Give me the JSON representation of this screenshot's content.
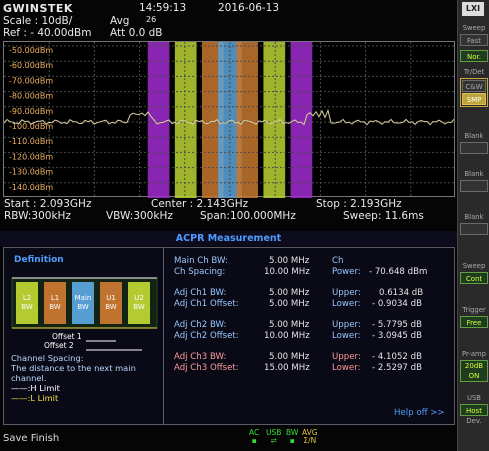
{
  "header": {
    "logo": "GWINSTEK",
    "time": "14:59:13",
    "date": "2016-06-13",
    "scale": "Scale : 10dB/",
    "avg": "Avg",
    "avg_value": "26",
    "ref": "Ref : - 40.00dBm",
    "att": "Att  0.0 dB"
  },
  "plot": {
    "y_labels": [
      "-50.00dBm",
      "-60.00dBm",
      "-70.00dBm",
      "-80.00dBm",
      "-90.00dBm",
      "-100.0dBm",
      "-110.0dBm",
      "-120.0dBm",
      "-130.0dBm",
      "-140.0dBm"
    ],
    "bands": [
      {
        "name": "L3",
        "color": "#a02cd0",
        "x_from": 0.318,
        "x_to": 0.366
      },
      {
        "name": "L2",
        "color": "#bcd432",
        "x_from": 0.378,
        "x_to": 0.426
      },
      {
        "name": "L1",
        "color": "#c87830",
        "x_from": 0.438,
        "x_to": 0.486
      },
      {
        "name": "Main",
        "color": "#5aa4dc",
        "x_from": 0.474,
        "x_to": 0.526
      },
      {
        "name": "U1",
        "color": "#c87830",
        "x_from": 0.514,
        "x_to": 0.562
      },
      {
        "name": "U2",
        "color": "#bcd432",
        "x_from": 0.574,
        "x_to": 0.622
      },
      {
        "name": "U3",
        "color": "#a02cd0",
        "x_from": 0.634,
        "x_to": 0.682
      }
    ]
  },
  "footer": {
    "start": "Start : 2.093GHz",
    "center": "Center : 2.143GHz",
    "stop": "Stop : 2.193GHz",
    "rbw": "RBW:300kHz",
    "vbw": "VBW:300kHz",
    "span": "Span:100.000MHz",
    "sweep": "Sweep: 11.6ms"
  },
  "acpr": {
    "title": "ACPR Measurement",
    "definition_title": "Definition",
    "blocks": [
      {
        "label": "L2\nBW",
        "color": "#bcd432"
      },
      {
        "label": "L1\nBW",
        "color": "#c87830"
      },
      {
        "label": "Main\nBW",
        "color": "#5aa4dc"
      },
      {
        "label": "U1\nBW",
        "color": "#c87830"
      },
      {
        "label": "U2\nBW",
        "color": "#bcd432"
      }
    ],
    "offset1": "Offset 1",
    "offset2": "Offset 2",
    "channel_spacing": "Channel Spacing:",
    "channel_spacing_desc": "The distance to the next main channel.",
    "h_limit": "——:H Limit",
    "l_limit": "——:L Limit",
    "main_ch_bw_label": "Main Ch BW:",
    "main_ch_bw_value": "5.00 MHz",
    "ch_spacing_label": "Ch Spacing:",
    "ch_spacing_value": "10.00 MHz",
    "ch_label": "Ch",
    "ch_power_label": "Power:",
    "ch_power_value": "- 70.648 dBm",
    "adj": [
      {
        "bw_label": "Adj Ch1 BW:",
        "bw_value": "5.00 MHz",
        "offset_label": "Adj Ch1 Offset:",
        "offset_value": "5.00 MHz",
        "upper": "0.6134 dB",
        "lower": "- 0.9034 dB",
        "tone": "b"
      },
      {
        "bw_label": "Adj Ch2 BW:",
        "bw_value": "5.00 MHz",
        "offset_label": "Adj Ch2 Offset:",
        "offset_value": "10.00 MHz",
        "upper": "- 5.7795 dB",
        "lower": "- 3.0945 dB",
        "tone": "b"
      },
      {
        "bw_label": "Adj Ch3 BW:",
        "bw_value": "5.00 MHz",
        "offset_label": "Adj Ch3 Offset:",
        "offset_value": "15.00 MHz",
        "upper": "- 4.1052 dB",
        "lower": "- 2.5297 dB",
        "tone": "r"
      }
    ],
    "upper_label": "Upper:",
    "lower_label": "Lower:",
    "help_off": "Help off >>"
  },
  "status": {
    "save": "Save Finish",
    "indicators": [
      "AC",
      "USB",
      "BW",
      "AVG"
    ],
    "avg_sub": "Σ/N"
  },
  "sidebar": {
    "sweep": "Sweep",
    "sweep_mode": "Fast",
    "nor": "Nor.",
    "trdet": "Tr/Det",
    "cw": "C&W",
    "smp": "SMP",
    "blank1": "Blank",
    "blank2": "Blank",
    "blank3": "Blank",
    "sweep2": "Sweep",
    "cont": "Cont",
    "trigger": "Trigger",
    "free": "Free",
    "preamp": "Pr-amp",
    "db": "20dB",
    "preamp_on": "ON",
    "usb": "USB",
    "host": "Host",
    "dev": "Dev."
  },
  "colors": {
    "accent": "#4f9cff",
    "trace": "#d8d0a0",
    "grid": "#3a3a3a",
    "on": "#d6ff3a"
  }
}
